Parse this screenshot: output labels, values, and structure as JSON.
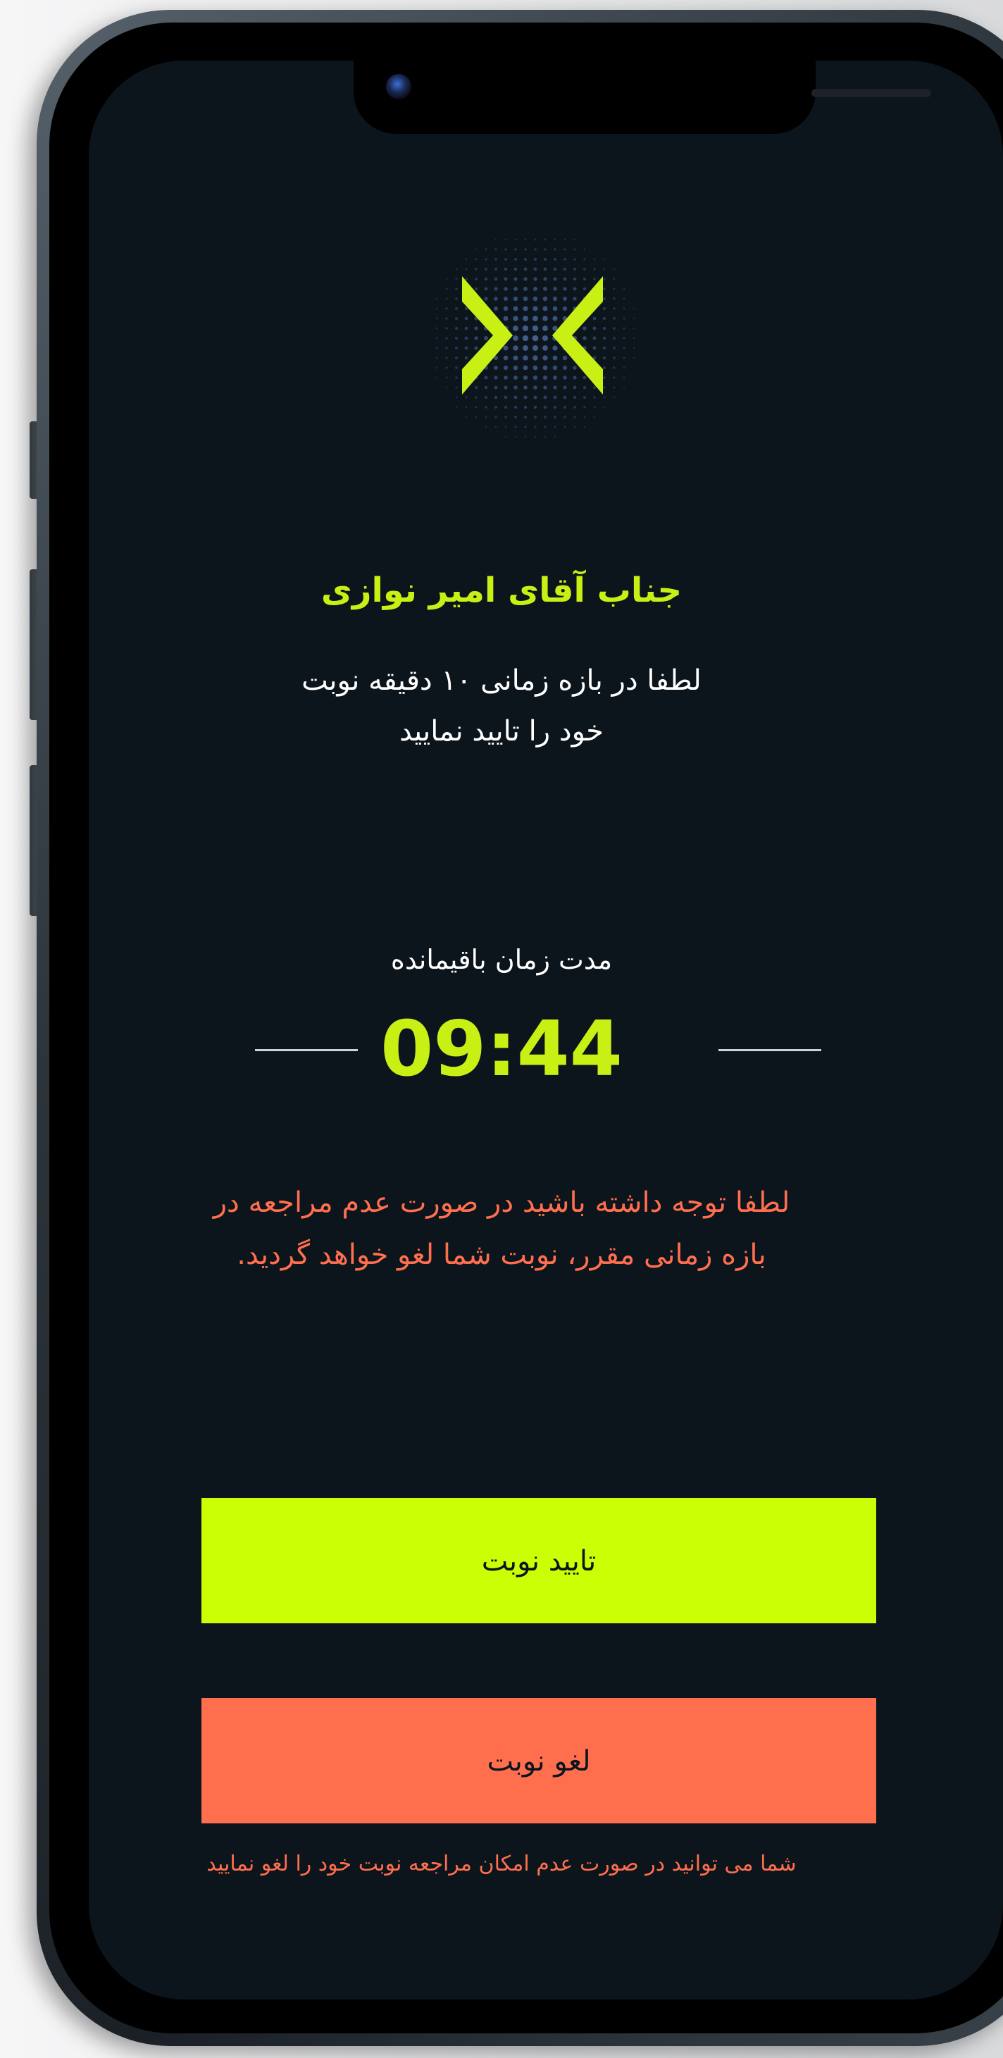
{
  "colors": {
    "accent": "#cbff05",
    "warning": "#ff6f4e",
    "background": "#0c141c",
    "text": "#ffffff"
  },
  "logo": {
    "icon": "x-chevrons-logo-icon"
  },
  "greeting": "جناب آقای امیر نوازی",
  "instruction": {
    "line1": "لطفا در بازه زمانی ۱۰ دقیقه نوبت",
    "line2": "خود را تایید نمایید"
  },
  "countdown": {
    "label": "مدت زمان باقیمانده",
    "time": "09:44"
  },
  "warning": {
    "line1": "لطفا توجه داشته باشید در صورت عدم مراجعه در",
    "line2": "بازه زمانی مقرر، نوبت شما لغو خواهد گردید."
  },
  "actions": {
    "confirm_label": "تایید نوبت",
    "cancel_label": "لغو نوبت"
  },
  "footnote": "شما می توانید در صورت عدم امکان مراجعه نوبت خود را لغو نمایید"
}
